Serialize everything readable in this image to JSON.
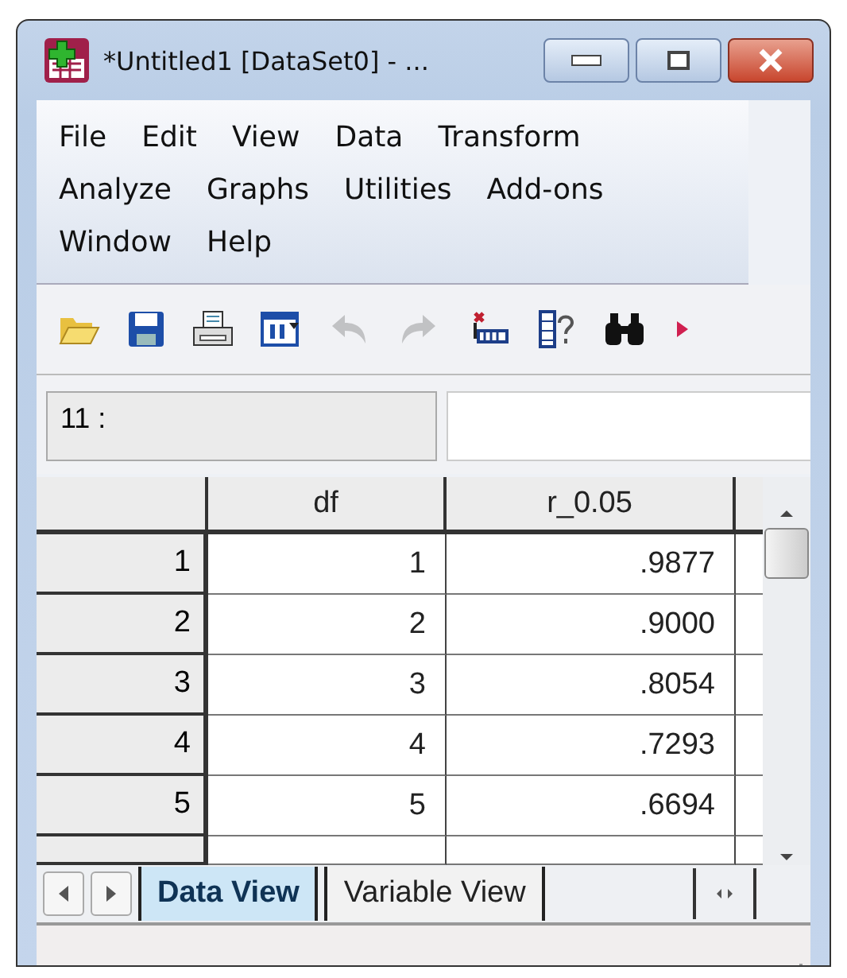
{
  "window": {
    "title": "*Untitled1 [DataSet0] - ..."
  },
  "menu": [
    {
      "label": "File"
    },
    {
      "label": "Edit"
    },
    {
      "label": "View"
    },
    {
      "label": "Data"
    },
    {
      "label": "Transform"
    },
    {
      "label": "Analyze"
    },
    {
      "label": "Graphs"
    },
    {
      "label": "Utilities"
    },
    {
      "label": "Add-ons"
    },
    {
      "label": "Window"
    },
    {
      "label": "Help"
    }
  ],
  "toolbar": [
    {
      "kind": "open",
      "disabled": false
    },
    {
      "kind": "save",
      "disabled": false
    },
    {
      "kind": "print",
      "disabled": false
    },
    {
      "kind": "dialog",
      "disabled": false
    },
    {
      "kind": "undo",
      "disabled": true
    },
    {
      "kind": "redo",
      "disabled": true
    },
    {
      "kind": "goto",
      "disabled": false
    },
    {
      "kind": "variables",
      "disabled": false
    },
    {
      "kind": "find",
      "disabled": false
    },
    {
      "kind": "more",
      "disabled": false
    }
  ],
  "cell_editor": {
    "reference": "11 :"
  },
  "table": {
    "columns": [
      "df",
      "r_0.05"
    ],
    "rows": [
      {
        "number": "1",
        "cells": [
          "1",
          ".9877"
        ]
      },
      {
        "number": "2",
        "cells": [
          "2",
          ".9000"
        ]
      },
      {
        "number": "3",
        "cells": [
          "3",
          ".8054"
        ]
      },
      {
        "number": "4",
        "cells": [
          "4",
          ".7293"
        ]
      },
      {
        "number": "5",
        "cells": [
          "5",
          ".6694"
        ]
      }
    ]
  },
  "tabs": [
    {
      "label": "Data View",
      "selected": true
    },
    {
      "label": "Variable View",
      "selected": false
    }
  ]
}
